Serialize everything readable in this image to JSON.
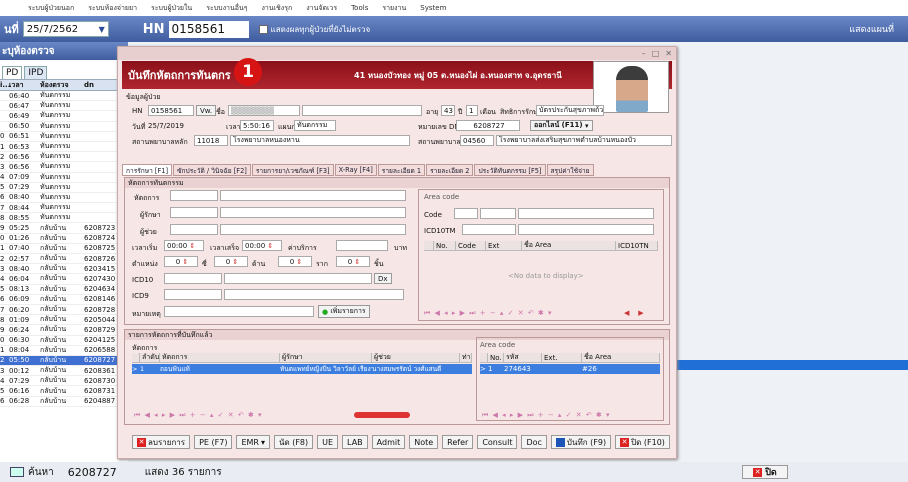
{
  "menubar": {
    "items": [
      "ระบบผู้ป่วยนอก",
      "ระบบห้องจ่ายยา",
      "ระบบผู้ป่วยใน",
      "ระบบงานอื่นๆ",
      "งานเชิงรุก",
      "งานจัดเวร",
      "Tools",
      "รายงาน",
      "System"
    ]
  },
  "toolbar": {
    "date_label": "นที่",
    "date_value": "25/7/2562",
    "hn_label": "HN",
    "hn_value": "0158561",
    "show_all_label": "แสดงผลทุกผู้ป่วยที่ยังไม่ตรวจ",
    "map_label": "แสดงแผนที่"
  },
  "left": {
    "header": "ะบุห้องตรวจ",
    "tabs": [
      "PD",
      "IPD"
    ],
    "columns": [
      "i...",
      "เวลา",
      "ห้องตรวจ",
      "dn"
    ],
    "rows": [
      [
        "",
        "06:40",
        "ทันตกรรม",
        ""
      ],
      [
        "",
        "06:47",
        "ทันตกรรม",
        ""
      ],
      [
        "",
        "06:49",
        "ทันตกรรม",
        ""
      ],
      [
        "",
        "06:50",
        "ทันตกรรม",
        ""
      ],
      [
        "0",
        "06:51",
        "ทันตกรรม",
        ""
      ],
      [
        "1",
        "06:53",
        "ทันตกรรม",
        ""
      ],
      [
        "2",
        "06:56",
        "ทันตกรรม",
        ""
      ],
      [
        "3",
        "06:56",
        "ทันตกรรม",
        ""
      ],
      [
        "4",
        "07:09",
        "ทันตกรรม",
        ""
      ],
      [
        "5",
        "07:29",
        "ทันตกรรม",
        ""
      ],
      [
        "6",
        "08:40",
        "ทันตกรรม",
        ""
      ],
      [
        "7",
        "08:44",
        "ทันตกรรม",
        ""
      ],
      [
        "8",
        "08:55",
        "ทันตกรรม",
        ""
      ],
      [
        "9",
        "05:25",
        "กลับบ้าน",
        "6208723"
      ],
      [
        "0",
        "01:26",
        "กลับบ้าน",
        "6208724"
      ],
      [
        "1",
        "07:40",
        "กลับบ้าน",
        "6208725"
      ],
      [
        "2",
        "02:57",
        "กลับบ้าน",
        "6208726"
      ],
      [
        "3",
        "08:40",
        "กลับบ้าน",
        "6203415"
      ],
      [
        "4",
        "06:04",
        "กลับบ้าน",
        "6207430"
      ],
      [
        "5",
        "08:13",
        "กลับบ้าน",
        "6204634"
      ],
      [
        "6",
        "06:09",
        "กลับบ้าน",
        "6208146"
      ],
      [
        "7",
        "06:20",
        "กลับบ้าน",
        "6208728"
      ],
      [
        "8",
        "01:09",
        "กลับบ้าน",
        "6205044"
      ],
      [
        "9",
        "06:24",
        "กลับบ้าน",
        "6208729"
      ],
      [
        "0",
        "06:30",
        "กลับบ้าน",
        "6204125"
      ],
      [
        "1",
        "08:04",
        "กลับบ้าน",
        "6206588"
      ],
      [
        "2",
        "05:50",
        "กลับบ้าน",
        "6208727"
      ],
      [
        "3",
        "00:12",
        "กลับบ้าน",
        "6208361"
      ],
      [
        "4",
        "07:29",
        "กลับบ้าน",
        "6208730"
      ],
      [
        "5",
        "06:16",
        "กลับบ้าน",
        "6208731"
      ],
      [
        "6",
        "06:28",
        "กลับบ้าน",
        "6204887"
      ]
    ],
    "selected_index": 26
  },
  "dialog": {
    "title": "บันทึกหัตถการทันตกร",
    "badge": "1",
    "address": "41 หนองบัวทอง หมู่ 05 ต.หนองไผ่ อ.หนองสาท จ.อุดรธานี",
    "patient_section": "ข้อมูลผู้ป่วย",
    "hn_label": "HN",
    "hn_value": "0158561",
    "vw_btn": "Vw.",
    "name_label": "ชื่อ",
    "age_label": "อายุ",
    "age_years": "43",
    "year_unit": "ปี",
    "age_months": "1",
    "month_unit": "เดือน",
    "right_label": "สิทธิการรักษา",
    "right_value": "บัตรประกันสุขภาพถ้วนหน้า(UCS",
    "date_label": "วันที่",
    "date_value": "25/7/2019",
    "time_label": "เวลา",
    "time_value": "5:50:16",
    "dept_label": "แผนก",
    "dept_value": "ทันตกรรม",
    "dn_label": "หมายเลข DN",
    "dn_value": "6208727",
    "online_btn": "ออกไลน์ (F11)",
    "main_hosp_label": "สถานพยาบาลหลัก",
    "main_hosp_code": "11018",
    "main_hosp_name": "โรงพยาบาลหนองหาน",
    "sec_hosp_label": "สถานพยาบาลรอง",
    "sec_hosp_code": "04560",
    "sec_hosp_name": "โรงพยาบาลส่งเสริมสุขภาพตำบลบ้านหนองบัว",
    "tabs": [
      "การรักษา [F1]",
      "ซักประวัติ / วินิจฉัย [F2]",
      "รายการยา/เวชภัณฑ์ [F3]",
      "X-Ray [F4]",
      "รายละเอียด 1",
      "รายละเอียด 2",
      "ประวัติทันตกรรม [F5]",
      "สรุปค่าใช้จ่าย"
    ],
    "proc_section": "หัตถการทันตกรรม",
    "proc_label": "หัตถการ",
    "doctor_label": "ผู้รักษา",
    "assistant_label": "ผู้ช่วย",
    "start_label": "เวลาเริ่ม",
    "start_value": "00:00",
    "end_label": "เวลาเสร็จ",
    "end_value": "00:00",
    "fee_label": "ค่าบริการ",
    "fee_unit": "บาท",
    "position_label": "ตำแหน่ง",
    "pos1": "0",
    "pos_unit1": "ซี่",
    "pos2": "0",
    "pos_unit2": "ด้าน",
    "pos3": "0",
    "pos_unit3": "ราก",
    "pos4": "0",
    "pos_unit4": "ชิ้น",
    "icd10_label": "ICD10",
    "icd9_label": "ICD9",
    "dx_btn": "Dx",
    "note_label": "หมายเหตุ",
    "add_btn": "เพิ่มรายการ",
    "area_title": "Area code",
    "code_label": "Code",
    "icd10tm_label": "ICD10TM",
    "area_cols": [
      "No.",
      "Code",
      "Ext",
      "ชื่อ Area",
      "ICD10TN"
    ],
    "no_data": "<No data to display>",
    "saved_section": "รายการหัตถการที่บันทึกแล้ว",
    "saved_sub": "หัตถการ",
    "saved_cols": [
      "ลำดับ",
      "หัตถการ",
      "ผู้รักษา",
      "ผู้ช่วย",
      "ท่า"
    ],
    "saved_row": [
      "1",
      "ถอนฟันแท้",
      "ทันตแพทย์หญิงปิ่น วิลาวัลย์ เรียงาม",
      "นางสมพรรัตน์ วงศ์แสนดี",
      ""
    ],
    "area2_title": "Area code",
    "area2_cols": [
      "No.",
      "รหัส",
      "Ext.",
      "ชื่อ Area"
    ],
    "area2_row": [
      "1",
      "274643",
      "",
      "#26"
    ],
    "footer": [
      "ลบรายการ",
      "PE (F7)",
      "EMR",
      "นัด (F8)",
      "UE",
      "LAB",
      "Admit",
      "Note",
      "Refer",
      "Consult",
      "Doc",
      "บันทึก (F9)",
      "ปิด (F10)"
    ]
  },
  "bottom": {
    "search_label": "ค้นหา",
    "search_value": "6208727",
    "count_label": "แสดง 36 รายการ",
    "close_label": "ปิด"
  }
}
